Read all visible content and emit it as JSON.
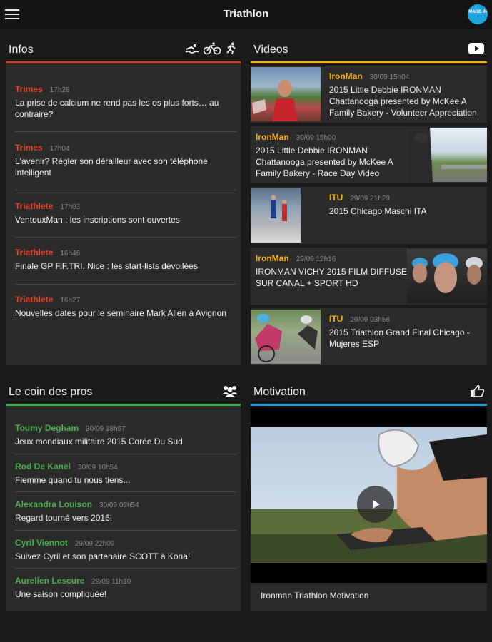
{
  "app": {
    "title": "Triathlon",
    "badge": "MADE IN",
    "menu_icon": "hamburger-icon"
  },
  "colors": {
    "infos": "#d3402a",
    "videos": "#f2b20e",
    "pros": "#3fa84a",
    "motivation": "#1e9ad6"
  },
  "infos": {
    "title": "Infos",
    "items": [
      {
        "source": "Trimes",
        "time": "17h28",
        "text": "La prise de calcium ne rend pas les os plus forts… au contraire?"
      },
      {
        "source": "Trimes",
        "time": "17h04",
        "text": "L'avenir? Régler son dérailleur avec son téléphone intelligent"
      },
      {
        "source": "Triathlete",
        "time": "17h03",
        "text": "VentouxMan : les inscriptions sont ouvertes"
      },
      {
        "source": "Triathlete",
        "time": "16h46",
        "text": "Finale GP F.F.TRI. Nice : les start-lists dévoilées"
      },
      {
        "source": "Triathlete",
        "time": "16h27",
        "text": "Nouvelles dates pour le séminaire Mark Allen à Avignon"
      }
    ]
  },
  "videos": {
    "title": "Videos",
    "items": [
      {
        "source": "IronMan",
        "time": "30/09 15h04",
        "text": "2015 Little Debbie IRONMAN Chattanooga presented by McKee A Family Bakery - Volunteer Appreciation"
      },
      {
        "source": "IronMan",
        "time": "30/09 15h00",
        "text": "2015 Little Debbie IRONMAN Chattanooga presented by McKee A Family Bakery - Race Day Video"
      },
      {
        "source": "ITU",
        "time": "29/09 21h29",
        "text": "2015 Chicago Maschi ITA"
      },
      {
        "source": "IronMan",
        "time": "29/09 12h16",
        "text": "IRONMAN VICHY 2015 FILM DIFFUSE SUR CANAL + SPORT HD"
      },
      {
        "source": "ITU",
        "time": "29/09 03h56",
        "text": "2015 Triathlon Grand Final Chicago - Mujeres ESP"
      }
    ]
  },
  "pros": {
    "title": "Le coin des pros",
    "items": [
      {
        "name": "Toumy Degham",
        "time": "30/09 18h57",
        "text": "Jeux mondiaux militaire 2015 Corée Du Sud"
      },
      {
        "name": "Rod De Kanel",
        "time": "30/09 10h54",
        "text": "Flemme quand tu nous tiens..."
      },
      {
        "name": "Alexandra Louison",
        "time": "30/09 09h54",
        "text": "Regard tourné vers 2016!"
      },
      {
        "name": "Cyril Viennot",
        "time": "29/09 22h09",
        "text": "Suivez Cyril et son partenaire SCOTT à Kona!"
      },
      {
        "name": "Aurelien Lescure",
        "time": "29/09 11h10",
        "text": "Une saison compliquée!"
      }
    ]
  },
  "motivation": {
    "title": "Motivation",
    "caption": "Ironman Triathlon Motivation"
  }
}
